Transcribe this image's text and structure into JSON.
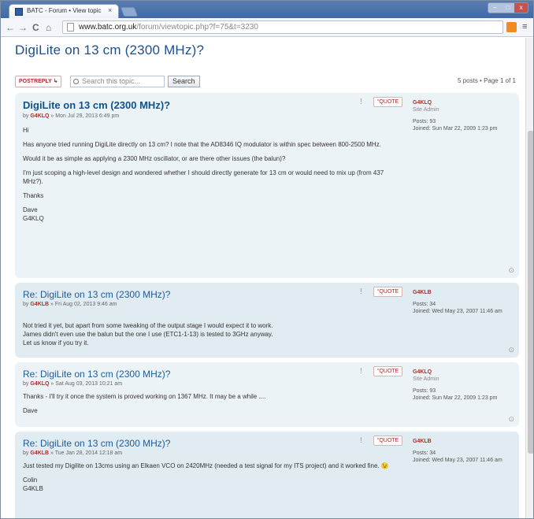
{
  "browser": {
    "tab_title": "BATC - Forum • View topic",
    "tab_close": "×",
    "url_host": "www.batc.org.uk",
    "url_rest": "/forum/viewtopic.php?f=75&t=3230",
    "nav_back": "←",
    "nav_forward": "→",
    "nav_reload": "C",
    "nav_home": "⌂",
    "menu": "≡",
    "win_min": "–",
    "win_max": "□",
    "win_close": "x"
  },
  "topic": {
    "title": "DigiLite on 13 cm (2300 MHz)?",
    "post_reply_label": "POSTREPLY ↳",
    "search_placeholder": "Search this topic...",
    "search_button": "Search",
    "pagination": "5 posts • Page 1 of 1"
  },
  "posts": [
    {
      "title": "DigiLite on 13 cm (2300 MHz)?",
      "byline_prefix": "by",
      "author": "G4KLQ",
      "date": " » Mon Jul 29, 2013 6:49 pm",
      "body": [
        "Hi",
        "Has anyone tried running DigiLite directly on 13 cm? I note that the AD8346 IQ modulator is within spec between 800-2500 MHz.",
        "Would it be as simple as applying a 2300 MHz oscillator, or are there other issues (the balun)?",
        "I'm just scoping a high-level design and wondered whether I should directly generate for 13 cm or would need to mix up (from 437 MHz?).",
        "Thanks",
        "Dave\nG4KLQ"
      ],
      "quote_label": "“QUOTE",
      "profile_user": "G4KLQ",
      "profile_rank": "Site Admin",
      "profile_posts": "Posts: 93",
      "profile_joined": "Joined: Sun Mar 22, 2009 1:23 pm"
    },
    {
      "title": "Re: DigiLite on 13 cm (2300 MHz)?",
      "byline_prefix": "by",
      "author": "G4KLB",
      "date": " » Fri Aug 02, 2013 9:46 am",
      "body": [
        "Not tried it yet, but apart from some tweaking of the output stage I would expect it to work.\nJames didn't even use the balun but the one I use (ETC1-1-13) is tested to 3GHz anyway.\nLet us know if you try it."
      ],
      "quote_label": "“QUOTE",
      "profile_user": "G4KLB",
      "profile_rank": "",
      "profile_posts": "Posts: 34",
      "profile_joined": "Joined: Wed May 23, 2007 11:46 am"
    },
    {
      "title": "Re: DigiLite on 13 cm (2300 MHz)?",
      "byline_prefix": "by",
      "author": "G4KLQ",
      "date": " » Sat Aug 03, 2013 10:21 am",
      "body": [
        "Thanks - I'll try it once the system is proved working on 1367 MHz. It may be a while ....",
        "Dave"
      ],
      "quote_label": "“QUOTE",
      "profile_user": "G4KLQ",
      "profile_rank": "Site Admin",
      "profile_posts": "Posts: 93",
      "profile_joined": "Joined: Sun Mar 22, 2009 1:23 pm"
    },
    {
      "title": "Re: DigiLite on 13 cm (2300 MHz)?",
      "byline_prefix": "by",
      "author": "G4KLB",
      "date": " » Tue Jan 28, 2014 12:18 am",
      "body": [
        "Just tested my Digilite on 13cms using an Elkaen VCO on 2420MHz (needed a test signal for my ITS project) and it worked fine. 😉",
        "Colin\nG4KLB"
      ],
      "quote_label": "“QUOTE",
      "profile_user": "G4KLB",
      "profile_rank": "",
      "profile_posts": "Posts: 34",
      "profile_joined": "Joined: Wed May 23, 2007 11:46 am"
    }
  ],
  "icons": {
    "warn": "!",
    "top": "⊙"
  }
}
